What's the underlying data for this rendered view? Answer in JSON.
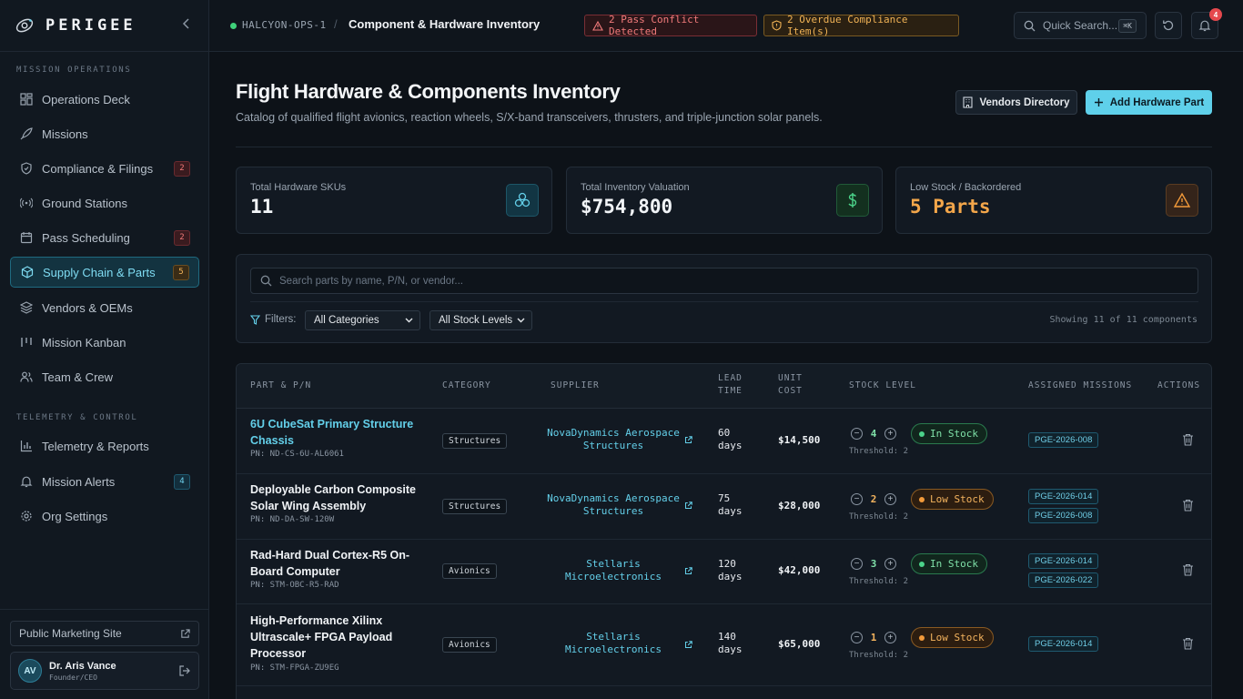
{
  "brand": {
    "name": "PERIGEE"
  },
  "sidebar": {
    "section1": "MISSION OPERATIONS",
    "section2": "TELEMETRY & CONTROL",
    "items": [
      {
        "label": "Operations Deck",
        "icon": "grid-icon"
      },
      {
        "label": "Missions",
        "icon": "rocket-icon"
      },
      {
        "label": "Compliance & Filings",
        "icon": "shield-icon",
        "badge": "2"
      },
      {
        "label": "Ground Stations",
        "icon": "broadcast-icon"
      },
      {
        "label": "Pass Scheduling",
        "icon": "calendar-icon",
        "badge": "2"
      },
      {
        "label": "Supply Chain & Parts",
        "icon": "cube-icon",
        "badge": "5",
        "active": true
      },
      {
        "label": "Vendors & OEMs",
        "icon": "layers-icon"
      },
      {
        "label": "Mission Kanban",
        "icon": "kanban-icon"
      },
      {
        "label": "Team & Crew",
        "icon": "users-icon"
      },
      {
        "label": "Telemetry & Reports",
        "icon": "bar-chart-icon"
      },
      {
        "label": "Mission Alerts",
        "icon": "bell-icon",
        "badge": "4"
      },
      {
        "label": "Org Settings",
        "icon": "gear-icon"
      }
    ],
    "marketing_link": "Public Marketing Site",
    "user": {
      "initials": "AV",
      "name": "Dr. Aris Vance",
      "role": "Founder/CEO"
    }
  },
  "topbar": {
    "workspace": "HALCYON-OPS-1",
    "separator": "/",
    "page": "Component & Hardware Inventory",
    "alert_conflict": "2 Pass Conflict Detected",
    "alert_compliance": "2 Overdue Compliance Item(s)",
    "search_label": "Quick Search...",
    "search_kbd": "⌘K",
    "notifications": "4"
  },
  "page": {
    "title": "Flight Hardware & Components Inventory",
    "subtitle": "Catalog of qualified flight avionics, reaction wheels, S/X-band transceivers, thrusters, and triple-junction solar panels.",
    "vendors_button": "Vendors Directory",
    "add_button": "Add Hardware Part"
  },
  "stats": [
    {
      "label": "Total Hardware SKUs",
      "value": "11",
      "color": "#f1f4f7"
    },
    {
      "label": "Total Inventory Valuation",
      "value": "$754,800",
      "color": "#f1f4f7"
    },
    {
      "label": "Low Stock / Backordered",
      "value": "5 Parts",
      "color": "#f3a64a"
    }
  ],
  "filters": {
    "search_placeholder": "Search parts by name, P/N, or vendor...",
    "label": "Filters:",
    "category": "All Categories",
    "stock": "All Stock Levels",
    "showing": "Showing 11 of 11 components"
  },
  "table": {
    "headers": {
      "part": "PART & P/N",
      "category": "CATEGORY",
      "supplier": "SUPPLIER",
      "lead1": "LEAD",
      "lead2": "TIME",
      "cost1": "UNIT",
      "cost2": "COST",
      "stock": "STOCK LEVEL",
      "missions": "ASSIGNED MISSIONS",
      "actions": "ACTIONS"
    },
    "rows": [
      {
        "name_l1": "6U CubeSat Primary Structure",
        "name_l2": "Chassis",
        "name_l3": "",
        "pn": "PN: ND-CS-6U-AL6061",
        "highlight": true,
        "category": "Structures",
        "supplier_l1": "NovaDynamics Aerospace",
        "supplier_l2": "Structures",
        "lead_l1": "60",
        "lead_l2": "days",
        "cost": "$14,500",
        "qty": "4",
        "status": "In Stock",
        "threshold": "Threshold: 2",
        "missions": [
          "PGE-2026-008"
        ]
      },
      {
        "name_l1": "Deployable Carbon Composite",
        "name_l2": "Solar Wing Assembly",
        "name_l3": "",
        "pn": "PN: ND-DA-SW-120W",
        "highlight": false,
        "category": "Structures",
        "supplier_l1": "NovaDynamics Aerospace",
        "supplier_l2": "Structures",
        "lead_l1": "75",
        "lead_l2": "days",
        "cost": "$28,000",
        "qty": "2",
        "status": "Low Stock",
        "threshold": "Threshold: 2",
        "missions": [
          "PGE-2026-014",
          "PGE-2026-008"
        ]
      },
      {
        "name_l1": "Rad-Hard Dual Cortex-R5 On-",
        "name_l2": "Board Computer",
        "name_l3": "",
        "pn": "PN: STM-OBC-R5-RAD",
        "highlight": false,
        "category": "Avionics",
        "supplier_l1": "Stellaris",
        "supplier_l2": "Microelectronics",
        "lead_l1": "120",
        "lead_l2": "days",
        "cost": "$42,000",
        "qty": "3",
        "status": "In Stock",
        "threshold": "Threshold: 2",
        "missions": [
          "PGE-2026-014",
          "PGE-2026-022"
        ]
      },
      {
        "name_l1": "High-Performance Xilinx",
        "name_l2": "Ultrascale+ FPGA Payload",
        "name_l3": "Processor",
        "pn": "PN: STM-FPGA-ZU9EG",
        "highlight": false,
        "category": "Avionics",
        "supplier_l1": "Stellaris",
        "supplier_l2": "Microelectronics",
        "lead_l1": "140",
        "lead_l2": "days",
        "cost": "$65,000",
        "qty": "1",
        "status": "Low Stock",
        "threshold": "Threshold: 2",
        "missions": [
          "PGE-2026-014"
        ]
      }
    ]
  },
  "colors": {
    "accent": "#5fd0ea",
    "ok": "#4bd48a",
    "warn": "#f29a3a",
    "danger": "#e5484d"
  }
}
